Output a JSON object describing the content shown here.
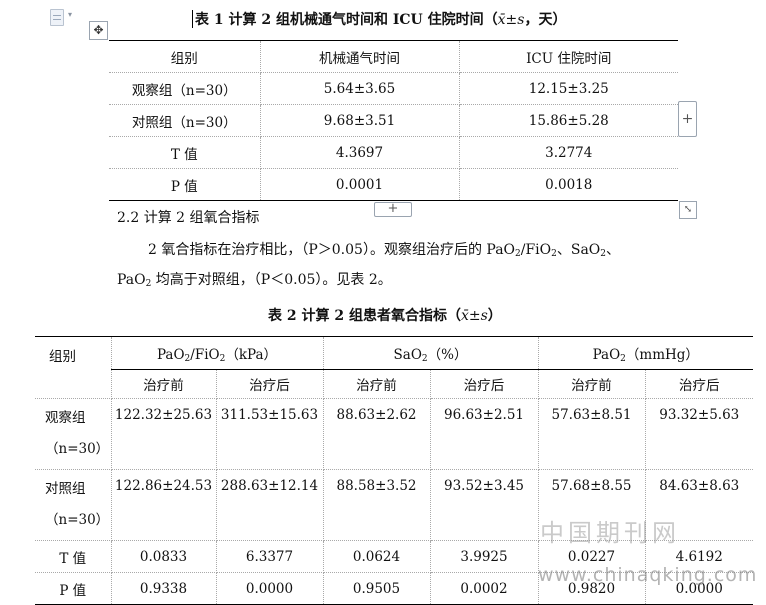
{
  "toolbar": {
    "doc_icon": "document-icon",
    "caret": "▾",
    "move_handle_glyph": "✥",
    "add_glyph": "+",
    "resize_glyph": "⤡"
  },
  "table1": {
    "caption": "表 1  计算 2 组机械通气时间和 ICU 住院时间（",
    "caption_formula": "x̄±s",
    "caption_tail": "，天）",
    "headers": [
      "组别",
      "机械通气时间",
      "ICU 住院时间"
    ],
    "rows": [
      [
        "观察组（n=30）",
        "5.64±3.65",
        "12.15±3.25"
      ],
      [
        "对照组（n=30）",
        "9.68±3.51",
        "15.86±5.28"
      ],
      [
        "T 值",
        "4.3697",
        "3.2774"
      ],
      [
        "P 值",
        "0.0001",
        "0.0018"
      ]
    ]
  },
  "text": {
    "heading": "2.2  计算 2 组氧合指标",
    "line1_a": "2 氧合指标在治疗相比，（P＞0.05）。观察组治疗后的 PaO",
    "line1_b": "/FiO",
    "line1_c": "、SaO",
    "line1_d": "、",
    "line2_a": "PaO",
    "line2_b": " 均高于对照组，（P＜0.05）。见表 2。",
    "sub2": "2"
  },
  "table2": {
    "caption": "表 2  计算 2 组患者氧合指标（",
    "caption_formula": "x̄±s",
    "caption_tail": "）",
    "group_label": "组别",
    "h_pao2fio2_a": "PaO",
    "h_pao2fio2_b": "/FiO",
    "h_pao2fio2_c": "（kPa）",
    "h_sao2_a": "SaO",
    "h_sao2_b": "（%）",
    "h_pao2_a": "PaO",
    "h_pao2_b": "（mmHg）",
    "before": "治疗前",
    "after": "治疗后",
    "rows": [
      {
        "label_a": "观察组",
        "label_b": "（n=30）",
        "v": [
          "122.32±25.63",
          "311.53±15.63",
          "88.63±2.62",
          "96.63±2.51",
          "57.63±8.51",
          "93.32±5.63"
        ]
      },
      {
        "label_a": "对照组",
        "label_b": "（n=30）",
        "v": [
          "122.86±24.53",
          "288.63±12.14",
          "88.58±3.52",
          "93.52±3.45",
          "57.68±8.55",
          "84.63±8.63"
        ]
      },
      {
        "label_a": "T 值",
        "v": [
          "0.0833",
          "6.3377",
          "0.0624",
          "3.9925",
          "0.0227",
          "4.6192"
        ]
      },
      {
        "label_a": "P 值",
        "v": [
          "0.9338",
          "0.0000",
          "0.9505",
          "0.0002",
          "0.9820",
          "0.0000"
        ]
      }
    ]
  },
  "watermark": {
    "cn": "中国期刊网",
    "url": "www.chinaqking.com"
  }
}
